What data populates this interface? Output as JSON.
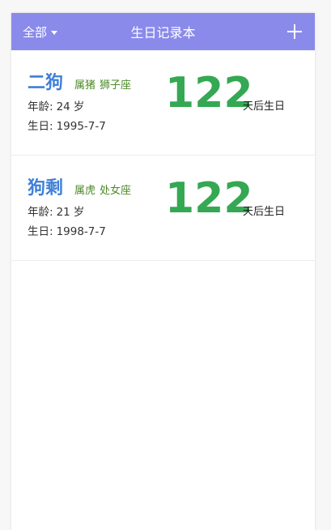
{
  "colors": {
    "header_bg": "#8a8aeb",
    "name": "#3f7fd8",
    "tag": "#4d8a2a",
    "days": "#34a853"
  },
  "header": {
    "filter_label": "全部",
    "title": "生日记录本",
    "add_icon": "plus-icon"
  },
  "labels": {
    "age_prefix": "年龄:",
    "age_unit": "岁",
    "birthday_prefix": "生日:",
    "days_suffix": "天后生日"
  },
  "records": [
    {
      "name": "二狗",
      "zodiac": "属猪",
      "constellation": "狮子座",
      "age": "24",
      "birthday": "1995-7-7",
      "days_left": "122"
    },
    {
      "name": "狗剩",
      "zodiac": "属虎",
      "constellation": "处女座",
      "age": "21",
      "birthday": "1998-7-7",
      "days_left": "122"
    }
  ]
}
